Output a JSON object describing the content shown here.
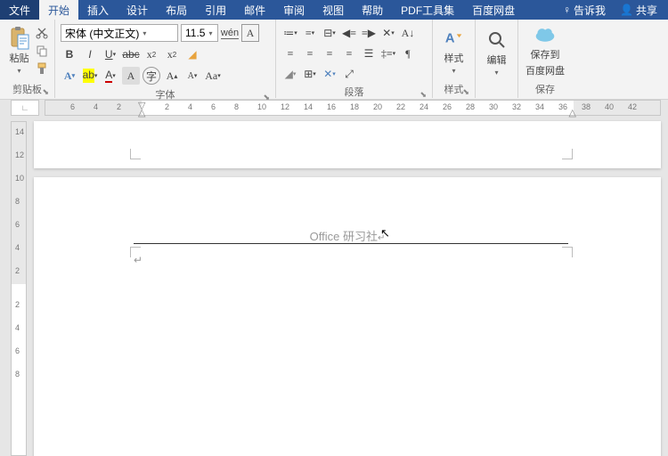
{
  "menu": {
    "file": "文件",
    "tabs": [
      "开始",
      "插入",
      "设计",
      "布局",
      "引用",
      "邮件",
      "审阅",
      "视图",
      "帮助",
      "PDF工具集",
      "百度网盘"
    ],
    "tell_me": "告诉我",
    "share": "共享"
  },
  "clipboard": {
    "paste": "粘贴",
    "label": "剪贴板"
  },
  "font": {
    "name": "宋体 (中文正文)",
    "size": "11.5",
    "label": "字体"
  },
  "paragraph": {
    "label": "段落"
  },
  "styles": {
    "btn": "样式",
    "label": "样式"
  },
  "editing": {
    "btn": "编辑"
  },
  "save": {
    "btn1": "保存到",
    "btn2": "百度网盘",
    "label": "保存"
  },
  "ruler": {
    "h": [
      "6",
      "4",
      "2",
      "2",
      "4",
      "6",
      "8",
      "10",
      "12",
      "14",
      "16",
      "18",
      "20",
      "22",
      "24",
      "26",
      "28",
      "30",
      "32",
      "34",
      "36",
      "38",
      "40",
      "42"
    ],
    "v": [
      "14",
      "12",
      "10",
      "8",
      "6",
      "4",
      "2",
      "2",
      "4",
      "6",
      "8"
    ]
  },
  "doc": {
    "header": "Office 研习社"
  }
}
